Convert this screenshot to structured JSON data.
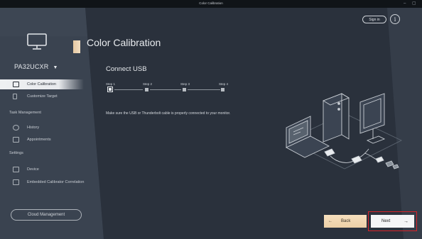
{
  "window": {
    "title": "Color Calibration",
    "minimize": "–",
    "restore": "▢"
  },
  "sidebar": {
    "model": "PA32UCXR",
    "items": [
      {
        "label": "Color Calibration",
        "icon": "color-calibration-icon",
        "active": true
      },
      {
        "label": "Customize Target",
        "icon": "customize-target-icon"
      }
    ],
    "task_management": {
      "heading": "Task Management",
      "items": [
        {
          "label": "History",
          "icon": "history-icon"
        },
        {
          "label": "Appointments",
          "icon": "calendar-icon"
        }
      ]
    },
    "settings": {
      "heading": "Settings",
      "items": [
        {
          "label": "Device",
          "icon": "monitor-icon"
        },
        {
          "label": "Embedded Calibrator Correlation",
          "icon": "calibrator-icon"
        }
      ]
    },
    "cloud_button": "Cloud Management"
  },
  "header": {
    "title": "Color Calibration",
    "sign_in": "Sign in",
    "info": "i"
  },
  "main": {
    "section_title": "Connect USB",
    "steps": [
      "Step 1",
      "Step 2",
      "Step 3",
      "Step 4"
    ],
    "current_step": 1,
    "description": "Make sure the USB or Thunderbolt cable is properly connected to your monitor."
  },
  "footer": {
    "back": "Back",
    "next": "Next"
  },
  "colors": {
    "accent": "#ecd2ad",
    "highlight": "#d9242a",
    "background": "#2c3440"
  }
}
